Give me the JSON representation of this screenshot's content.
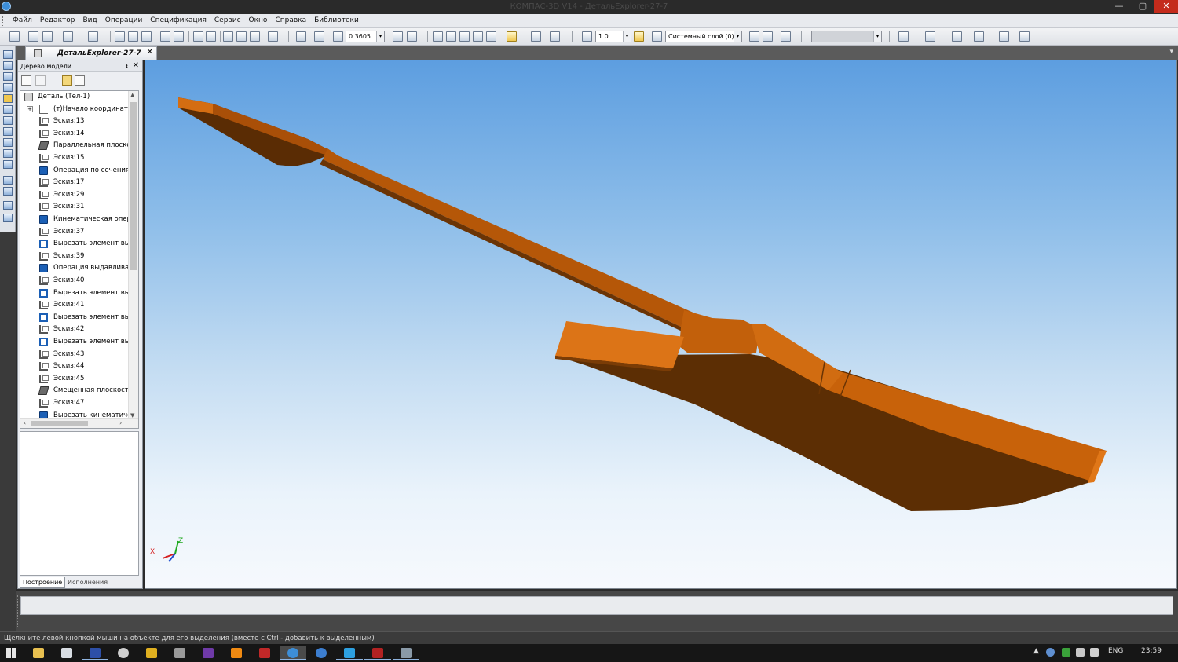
{
  "window": {
    "title": "КОМПАС-3D V14 - ДетальExplorer-27-7",
    "close_glyph": "✕",
    "min_glyph": "—",
    "max_glyph": "▢"
  },
  "menu": {
    "items": [
      "Файл",
      "Редактор",
      "Вид",
      "Операции",
      "Спецификация",
      "Сервис",
      "Окно",
      "Справка",
      "Библиотеки"
    ]
  },
  "toolbar": {
    "zoom_value": "0.3605",
    "step_value": "1.0",
    "layer_value": "Системный слой (0)",
    "dropdown_glyph": "▾"
  },
  "document": {
    "tab_label": "ДетальExplorer-27-7",
    "close_glyph": "✕"
  },
  "tree_panel": {
    "title": "Дерево модели",
    "pin_glyph": "ᵻ",
    "close_glyph": "✕",
    "root_label": "Деталь (Тел-1)",
    "items": [
      {
        "label": "(т)Начало координат",
        "icon": "origin-icon"
      },
      {
        "label": "Эскиз:13",
        "icon": "sketch-icon"
      },
      {
        "label": "Эскиз:14",
        "icon": "sketch-icon"
      },
      {
        "label": "Параллельная плоскость",
        "icon": "plane-icon"
      },
      {
        "label": "Эскиз:15",
        "icon": "sketch-icon"
      },
      {
        "label": "Операция по сечениям",
        "icon": "loft-icon"
      },
      {
        "label": "Эскиз:17",
        "icon": "sketch-icon"
      },
      {
        "label": "Эскиз:29",
        "icon": "sketch-icon"
      },
      {
        "label": "Эскиз:31",
        "icon": "sketch-icon"
      },
      {
        "label": "Кинематическая операция",
        "icon": "sweep-icon"
      },
      {
        "label": "Эскиз:37",
        "icon": "sketch-icon"
      },
      {
        "label": "Вырезать элемент выдавливания",
        "icon": "cut-extrude-icon"
      },
      {
        "label": "Эскиз:39",
        "icon": "sketch-icon"
      },
      {
        "label": "Операция выдавливания",
        "icon": "extrude-icon"
      },
      {
        "label": "Эскиз:40",
        "icon": "sketch-icon"
      },
      {
        "label": "Вырезать элемент выдавливания",
        "icon": "cut-extrude-icon"
      },
      {
        "label": "Эскиз:41",
        "icon": "sketch-icon"
      },
      {
        "label": "Вырезать элемент выдавливания",
        "icon": "cut-extrude-icon"
      },
      {
        "label": "Эскиз:42",
        "icon": "sketch-icon"
      },
      {
        "label": "Вырезать элемент выдавливания",
        "icon": "cut-extrude-icon"
      },
      {
        "label": "Эскиз:43",
        "icon": "sketch-icon"
      },
      {
        "label": "Эскиз:44",
        "icon": "sketch-icon"
      },
      {
        "label": "Эскиз:45",
        "icon": "sketch-icon"
      },
      {
        "label": "Смещенная плоскость",
        "icon": "plane-icon"
      },
      {
        "label": "Эскиз:47",
        "icon": "sketch-icon"
      },
      {
        "label": "Вырезать кинематическим",
        "icon": "cut-sweep-icon"
      }
    ],
    "tabs": [
      "Построение",
      "Исполнения"
    ]
  },
  "viewport": {
    "model_color": "#c8620a",
    "axis_x": "X",
    "axis_z": "Z"
  },
  "status": {
    "message": "Щелкните левой кнопкой мыши на объекте для его выделения (вместе с Ctrl - добавить к выделенным)"
  },
  "taskbar": {
    "lang": "ENG",
    "time": "23:59"
  }
}
